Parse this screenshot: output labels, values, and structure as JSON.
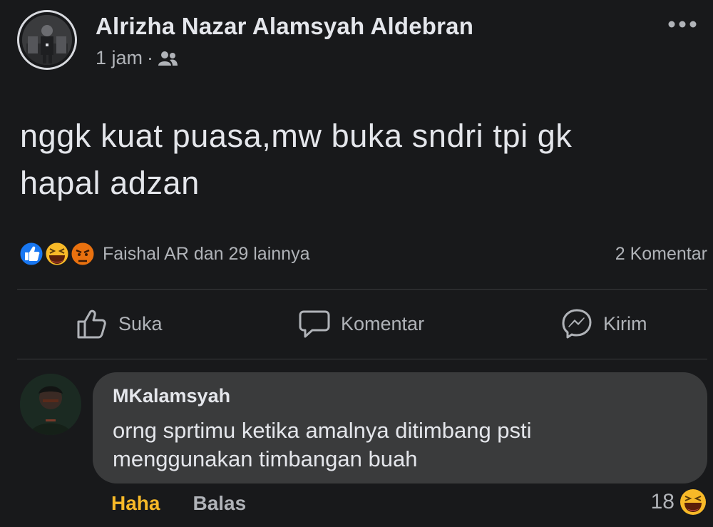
{
  "post": {
    "author": "Alrizha Nazar Alamsyah Aldebran",
    "time": "1 jam",
    "separator": "·",
    "audience_icon": "friends-icon",
    "more_icon": "more-dots-icon",
    "text_line1": "nggk kuat puasa,mw buka sndri tpi gk",
    "text_line2": "hapal adzan"
  },
  "reactions": {
    "icons": [
      "like-reaction-icon",
      "haha-reaction-icon",
      "angry-reaction-icon"
    ],
    "summary": "Faishal AR dan 29 lainnya",
    "comments": "2 Komentar"
  },
  "actions": {
    "like": "Suka",
    "comment": "Komentar",
    "send": "Kirim"
  },
  "comment": {
    "author": "MKalamsyah",
    "text_line1": "orng sprtimu ketika amalnya ditimbang psti",
    "text_line2": "menggunakan timbangan buah",
    "reaction_label": "Haha",
    "reply_label": "Balas",
    "reaction_count": "18",
    "reaction_icon": "haha-reaction-icon"
  },
  "colors": {
    "background": "#18191b",
    "bubble": "#3a3b3c",
    "text_primary": "#e4e6eb",
    "text_secondary": "#b0b3b8",
    "haha_accent": "#f7b928",
    "like_blue": "#1877f2",
    "angry_orange": "#e9710f"
  }
}
